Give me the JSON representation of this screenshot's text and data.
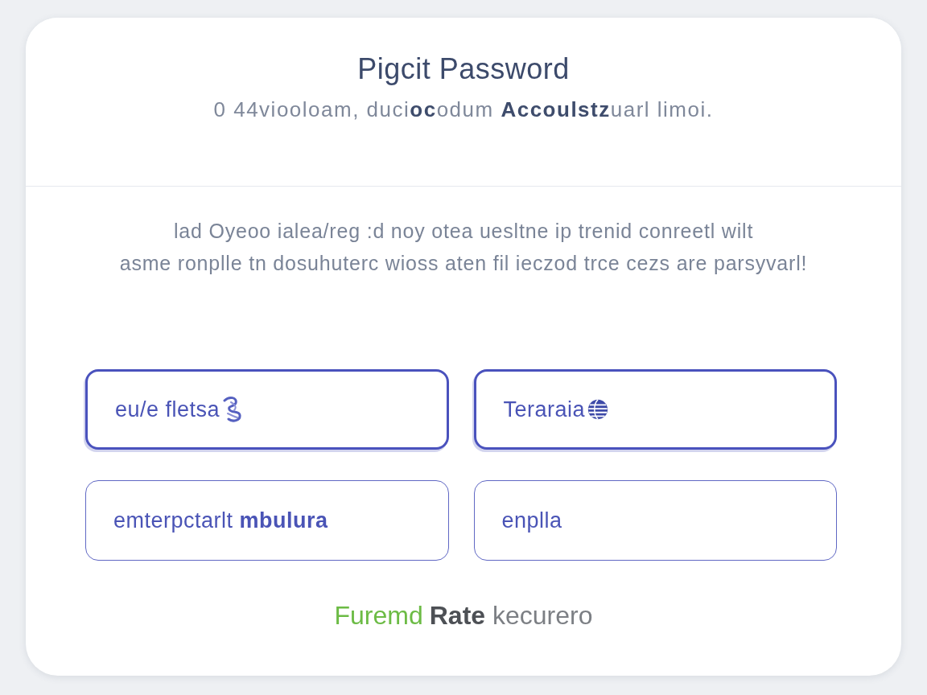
{
  "header": {
    "title": "Pigcit Password",
    "subtitle": "0 44viooloam, duci**oc**odum **Accoulstz**uarl limoi."
  },
  "instructions": "lad Oyeoo ialea/reg :d noy otea uesltne ip trenid conreetl wilt\nasme ronplle tn dosuhuterc wioss aten fil ieczod trce cezs are parsyvarl!",
  "fields": [
    {
      "kind": "scribble",
      "value": "eu/e fletsa",
      "focused": true
    },
    {
      "kind": "globe",
      "value": "Teraraia",
      "focused": true
    },
    {
      "kind": "text",
      "value": "emterpctarlt **mbulura**",
      "focused": false
    },
    {
      "kind": "text",
      "value": "enplla",
      "focused": false
    }
  ],
  "footer": {
    "link": "Furemd",
    "text": "**Rate** kecurero"
  }
}
